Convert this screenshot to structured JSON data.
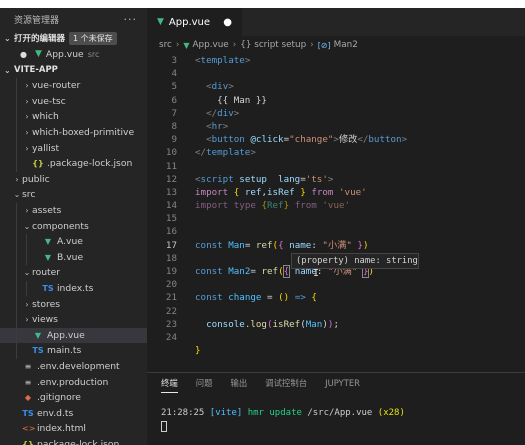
{
  "explorer": {
    "title": "资源管理器",
    "more": "···",
    "open_editors": {
      "label": "打开的编辑器",
      "badge": "1 个未保存"
    },
    "open_files": [
      {
        "dot": "●",
        "name": "App.vue",
        "dir": "src"
      }
    ],
    "project": "VITE-APP",
    "tree": [
      {
        "name": "vue-router",
        "chev": "›",
        "icon": "",
        "indent": 1
      },
      {
        "name": "vue-tsc",
        "chev": "›",
        "icon": "",
        "indent": 1
      },
      {
        "name": "which",
        "chev": "›",
        "icon": "",
        "indent": 1
      },
      {
        "name": "which-boxed-primitive",
        "chev": "›",
        "icon": "",
        "indent": 1
      },
      {
        "name": "yallist",
        "chev": "›",
        "icon": "",
        "indent": 1
      },
      {
        "name": ".package-lock.json",
        "chev": "",
        "icon": "{}",
        "kind": "json",
        "indent": 1
      },
      {
        "name": "public",
        "chev": "›",
        "icon": "",
        "indent": 0
      },
      {
        "name": "src",
        "chev": "⌄",
        "icon": "",
        "indent": 0
      },
      {
        "name": "assets",
        "chev": "›",
        "icon": "",
        "indent": 1
      },
      {
        "name": "components",
        "chev": "⌄",
        "icon": "",
        "indent": 1
      },
      {
        "name": "A.vue",
        "chev": "",
        "icon": "▼",
        "kind": "vue",
        "indent": 2
      },
      {
        "name": "B.vue",
        "chev": "",
        "icon": "▼",
        "kind": "vue",
        "indent": 2
      },
      {
        "name": "router",
        "chev": "⌄",
        "icon": "",
        "indent": 1
      },
      {
        "name": "index.ts",
        "chev": "",
        "icon": "TS",
        "kind": "ts",
        "indent": 2
      },
      {
        "name": "stores",
        "chev": "›",
        "icon": "",
        "indent": 1
      },
      {
        "name": "views",
        "chev": "›",
        "icon": "",
        "indent": 1
      },
      {
        "name": "App.vue",
        "chev": "",
        "icon": "▼",
        "kind": "vue",
        "indent": 1,
        "selected": true
      },
      {
        "name": "main.ts",
        "chev": "",
        "icon": "TS",
        "kind": "ts",
        "indent": 1
      },
      {
        "name": ".env.development",
        "chev": "",
        "icon": "≡",
        "kind": "env",
        "indent": 0
      },
      {
        "name": ".env.production",
        "chev": "",
        "icon": "≡",
        "kind": "env",
        "indent": 0
      },
      {
        "name": ".gitignore",
        "chev": "",
        "icon": "◆",
        "kind": "gitig",
        "indent": 0
      },
      {
        "name": "env.d.ts",
        "chev": "",
        "icon": "TS",
        "kind": "ts",
        "indent": 0
      },
      {
        "name": "index.html",
        "chev": "",
        "icon": "<>",
        "kind": "html5",
        "indent": 0
      },
      {
        "name": "package-lock.json",
        "chev": "",
        "icon": "{}",
        "kind": "json",
        "indent": 0
      }
    ]
  },
  "editor": {
    "tab": {
      "name": "App.vue",
      "dirty": "●"
    },
    "breadcrumb": {
      "src": "src",
      "file": "App.vue",
      "scope": "{} script setup",
      "symbol": "Man2"
    },
    "active_line": 17,
    "line_numbers": [
      3,
      4,
      5,
      6,
      7,
      8,
      9,
      10,
      11,
      12,
      13,
      14,
      15,
      16,
      17,
      18,
      19,
      20,
      21,
      22,
      23,
      24
    ],
    "hover": "(property) name: string"
  },
  "panel": {
    "tabs": [
      "终端",
      "问题",
      "输出",
      "调试控制台",
      "JUPYTER"
    ],
    "active_tab": "终端",
    "terminal": {
      "time": "21:28:25",
      "tag": "[vite]",
      "msg": "hmr update",
      "path": "/src/App.vue",
      "count": "(x28)"
    }
  }
}
